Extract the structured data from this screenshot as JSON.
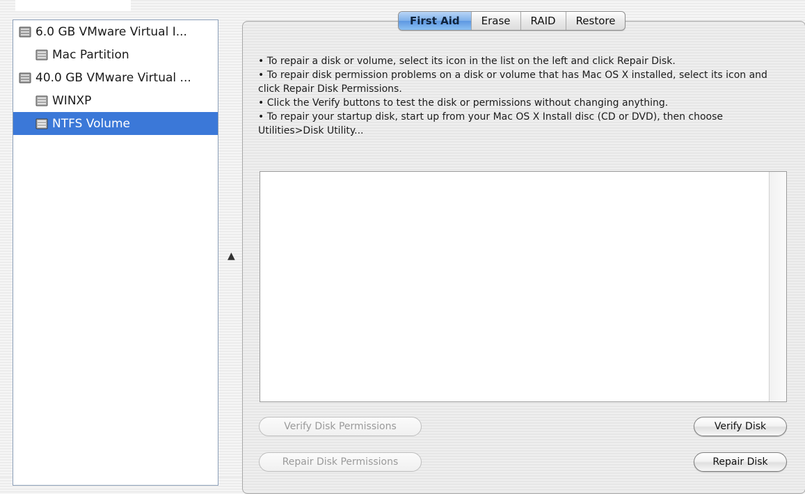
{
  "colors": {
    "selection": "#3b78d8",
    "active_tab": "#6aa3e6"
  },
  "sidebar": {
    "items": [
      {
        "label": "6.0 GB VMware Virtual I...",
        "icon": "hard-disk-icon",
        "level": 0,
        "selected": false
      },
      {
        "label": "Mac Partition",
        "icon": "volume-icon",
        "level": 1,
        "selected": false
      },
      {
        "label": "40.0 GB VMware Virtual ...",
        "icon": "hard-disk-icon",
        "level": 0,
        "selected": false
      },
      {
        "label": "WINXP",
        "icon": "volume-icon",
        "level": 1,
        "selected": false
      },
      {
        "label": "NTFS Volume",
        "icon": "volume-icon",
        "level": 1,
        "selected": true
      }
    ]
  },
  "tabs": [
    {
      "label": "First Aid",
      "active": true
    },
    {
      "label": "Erase",
      "active": false
    },
    {
      "label": "RAID",
      "active": false
    },
    {
      "label": "Restore",
      "active": false
    }
  ],
  "first_aid": {
    "instructions": [
      "To repair a disk or volume, select its icon in the list on the left and click Repair Disk.",
      "To repair disk permission problems on a disk or volume that has Mac OS X installed, select its icon and click Repair Disk Permissions.",
      "Click the Verify buttons to test the disk or permissions without changing anything.",
      "To repair your startup disk, start up from your Mac OS X Install disc (CD or DVD), then choose Utilities>Disk Utility..."
    ],
    "buttons": {
      "verify_permissions": "Verify Disk Permissions",
      "repair_permissions": "Repair Disk Permissions",
      "verify_disk": "Verify Disk",
      "repair_disk": "Repair Disk"
    }
  }
}
